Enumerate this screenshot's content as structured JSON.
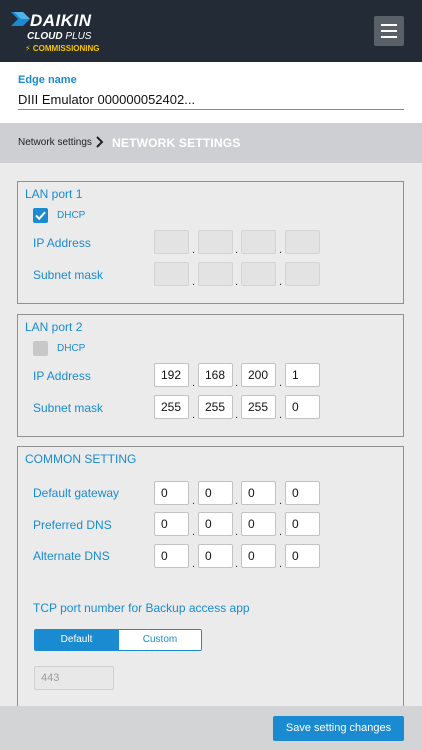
{
  "header": {
    "logo_text": "DAIKIN",
    "cloud_text": "CLOUD",
    "plus_text": "PLUS",
    "commissioning": "COMMISSIONING",
    "colors": {
      "background": "#232b36",
      "accent_yellow": "#f5c400"
    }
  },
  "edge": {
    "label": "Edge name",
    "value": "DIII Emulator 000000052402..."
  },
  "breadcrumb": {
    "link": "Network settings",
    "current": "NETWORK SETTINGS"
  },
  "lan1": {
    "title": "LAN port 1",
    "dhcp_label": "DHCP",
    "dhcp_checked": true,
    "ip_label": "IP Address",
    "ip": [
      "",
      "",
      "",
      ""
    ],
    "mask_label": "Subnet mask",
    "mask": [
      "",
      "",
      "",
      ""
    ]
  },
  "lan2": {
    "title": "LAN port 2",
    "dhcp_label": "DHCP",
    "dhcp_checked": false,
    "ip_label": "IP Address",
    "ip": [
      "192",
      "168",
      "200",
      "1"
    ],
    "mask_label": "Subnet mask",
    "mask": [
      "255",
      "255",
      "255",
      "0"
    ]
  },
  "common": {
    "title": "COMMON SETTING",
    "gateway_label": "Default gateway",
    "gateway": [
      "0",
      "0",
      "0",
      "0"
    ],
    "pdns_label": "Preferred DNS",
    "pdns": [
      "0",
      "0",
      "0",
      "0"
    ],
    "adns_label": "Alternate DNS",
    "adns": [
      "0",
      "0",
      "0",
      "0"
    ],
    "tcp_label": "TCP port number for Backup access app",
    "toggle_default": "Default",
    "toggle_custom": "Custom",
    "port_value": "443"
  },
  "footer": {
    "save_label": "Save setting changes"
  },
  "colors": {
    "accent": "#1a8bd1",
    "panel_bg": "#ebebeb",
    "crumb_bg": "#cdcfd2"
  }
}
